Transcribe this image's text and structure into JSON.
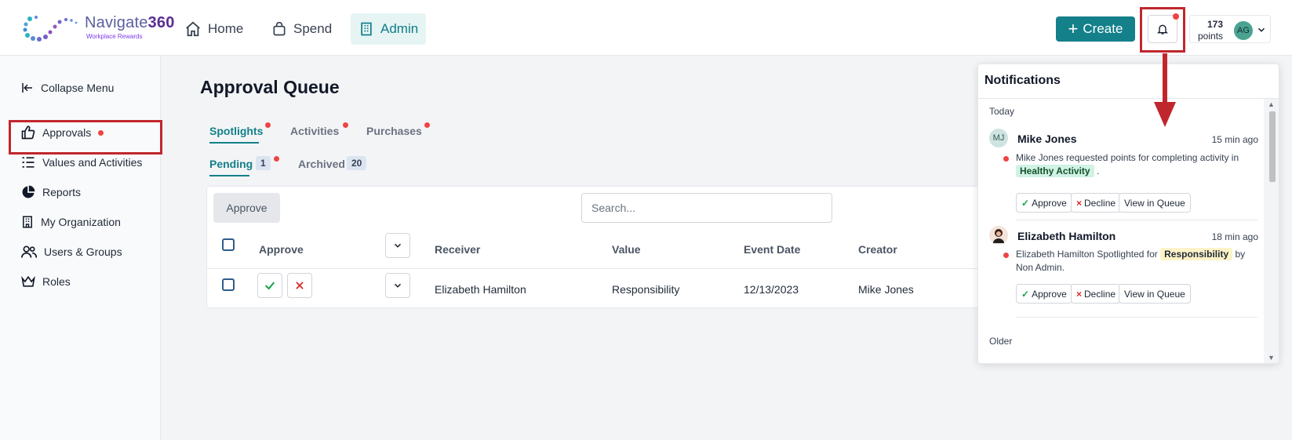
{
  "header": {
    "logo_name": "Navigate",
    "logo_number": "360",
    "logo_sub": "Workplace Rewards",
    "nav": {
      "home": "Home",
      "spend": "Spend",
      "admin": "Admin"
    },
    "create_label": "Create",
    "points_value": "173",
    "points_label": "points",
    "avatar_initials": "AG"
  },
  "sidebar": {
    "collapse_label": "Collapse Menu",
    "items": [
      {
        "label": "Approvals"
      },
      {
        "label": "Values and Activities"
      },
      {
        "label": "Reports"
      },
      {
        "label": "My Organization"
      },
      {
        "label": "Users & Groups"
      },
      {
        "label": "Roles"
      }
    ]
  },
  "main": {
    "title": "Approval Queue",
    "tabs": [
      "Spotlights",
      "Activities",
      "Purchases"
    ],
    "subtabs": [
      {
        "label": "Pending",
        "count": "1"
      },
      {
        "label": "Archived",
        "count": "20"
      }
    ],
    "approve_button": "Approve",
    "search_placeholder": "Search...",
    "columns": [
      "Approve",
      "Receiver",
      "Value",
      "Event Date",
      "Creator"
    ],
    "rows": [
      {
        "receiver": "Elizabeth Hamilton",
        "value": "Responsibility",
        "event_date": "12/13/2023",
        "creator": "Mike Jones"
      }
    ]
  },
  "notifications": {
    "title": "Notifications",
    "group_today": "Today",
    "group_older": "Older",
    "items": [
      {
        "initials": "MJ",
        "name": "Mike Jones",
        "time": "15 min ago",
        "message": "Mike Jones requested points for completing activity in",
        "tag": "Healthy Activity",
        "suffix": "."
      },
      {
        "name": "Elizabeth Hamilton",
        "time": "18 min ago",
        "message": "Elizabeth Hamilton Spotlighted for",
        "tag": "Responsibility",
        "suffix": "by Non Admin."
      }
    ],
    "actions": {
      "approve": "Approve",
      "decline": "Decline",
      "view": "View in Queue"
    }
  },
  "colors": {
    "accent": "#13808a",
    "highlight": "#c0272d",
    "unread": "#ef4444"
  }
}
